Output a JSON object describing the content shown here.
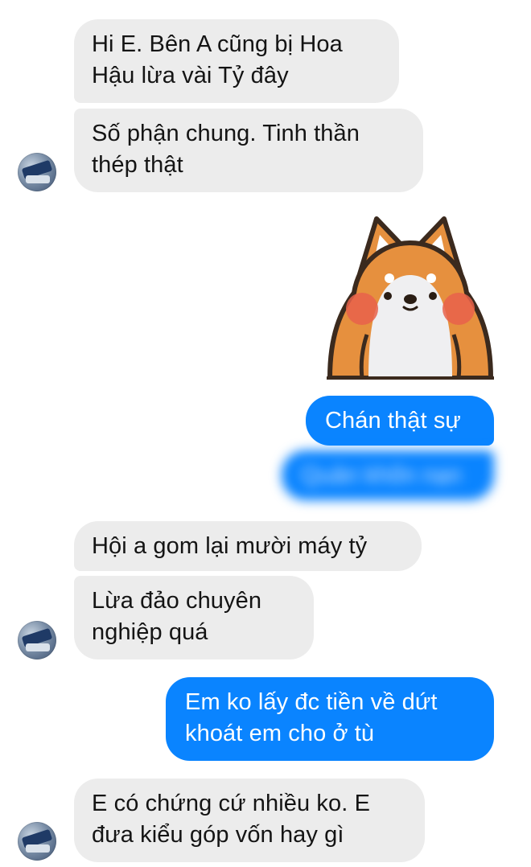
{
  "messages": [
    {
      "id": "m1",
      "side": "in",
      "text": "Hi E. Bên A cũng bị Hoa\nHậu lừa vài Tỷ đây"
    },
    {
      "id": "m2",
      "side": "in",
      "text": "Số phận chung. Tinh thần\nthép thật"
    },
    {
      "id": "m3",
      "side": "out",
      "text": "Chán thật sự"
    },
    {
      "id": "m4",
      "side": "out",
      "text": "Quản khốn nạn",
      "blurred": true
    },
    {
      "id": "m5",
      "side": "in",
      "text": "Hội a gom lại mười máy tỷ"
    },
    {
      "id": "m6",
      "side": "in",
      "text": "Lừa đảo chuyên\nnghiệp quá"
    },
    {
      "id": "m7",
      "side": "out",
      "text": "Em ko lấy đc tiền về dứt\nkhoát em cho ở tù"
    },
    {
      "id": "m8",
      "side": "in",
      "text": "E có chứng cứ nhiều ko. E\nđưa kiểu góp vốn hay gì"
    }
  ],
  "sticker": {
    "icon": "shiba-dog-sticker-icon"
  },
  "colors": {
    "incoming_bubble": "#ececec",
    "outgoing_bubble": "#0a84ff"
  }
}
